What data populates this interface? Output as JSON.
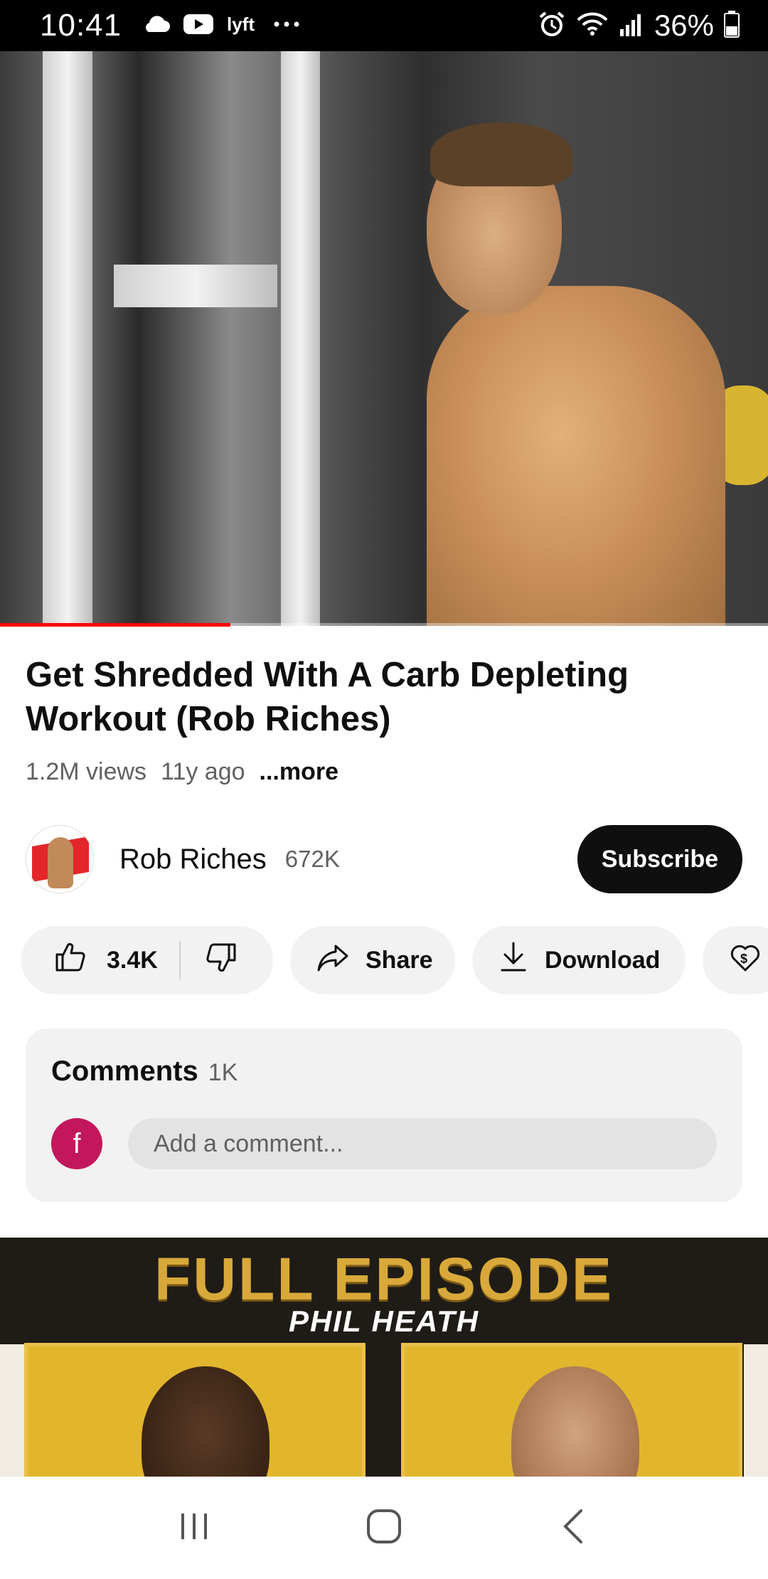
{
  "status_bar": {
    "time": "10:41",
    "battery": "36%",
    "left_icons": [
      "cloud-icon",
      "youtube-icon",
      "lyft-icon",
      "more-dots-icon"
    ],
    "right_icons": [
      "alarm-icon",
      "wifi-icon",
      "signal-icon",
      "battery-icon"
    ]
  },
  "video": {
    "progress": 0.3
  },
  "title": "Get Shredded With A Carb Depleting Workout (Rob Riches)",
  "meta": {
    "views": "1.2M views",
    "age": "11y ago",
    "more_label": "...more"
  },
  "channel": {
    "name": "Rob Riches",
    "subscribers": "672K",
    "subscribe_label": "Subscribe"
  },
  "actions": {
    "like_count": "3.4K",
    "share_label": "Share",
    "download_label": "Download"
  },
  "comments": {
    "heading": "Comments",
    "count": "1K",
    "avatar_letter": "f",
    "placeholder": "Add a comment..."
  },
  "next_video": {
    "headline": "FULL EPISODE",
    "guest": "PHIL HEATH"
  },
  "colors": {
    "accent_red": "#ff0000",
    "subscribe_bg": "#0f0f0f",
    "pill_bg": "#f2f2f2",
    "comment_avatar": "#c2185b"
  }
}
